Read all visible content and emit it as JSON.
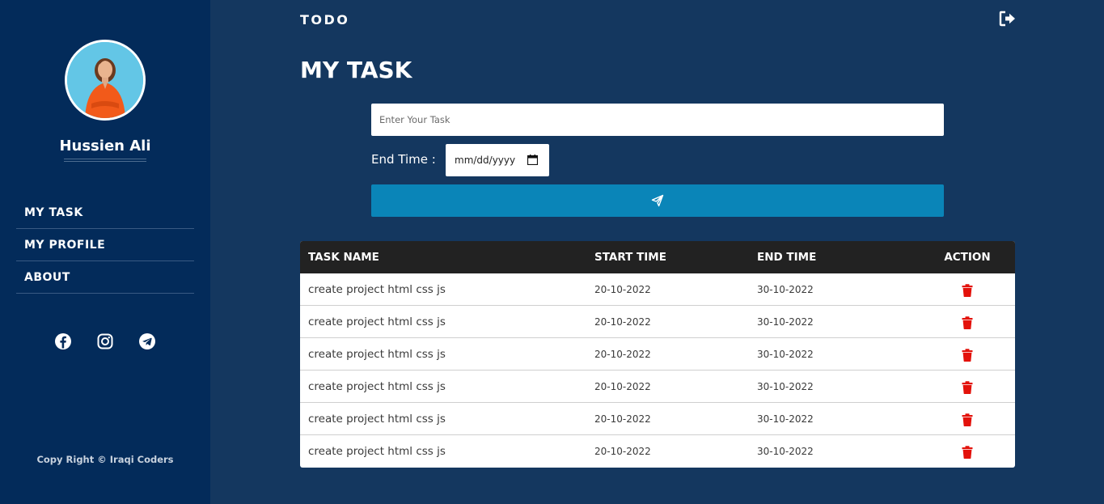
{
  "sidebar": {
    "user_name": "Hussien Ali",
    "nav": [
      {
        "label": "MY TASK"
      },
      {
        "label": "MY PROFILE"
      },
      {
        "label": "ABOUT"
      }
    ],
    "socials": [
      "facebook-icon",
      "instagram-icon",
      "telegram-icon"
    ],
    "copyright": "Copy Right © Iraqi Coders"
  },
  "header": {
    "brand": "TODO",
    "logout_icon": "sign-out-icon"
  },
  "main": {
    "title": "MY TASK",
    "task_placeholder": "Enter Your Task",
    "end_time_label": "End Time :",
    "date_placeholder": "mm/dd/yyyy",
    "submit_icon": "paper-plane-icon"
  },
  "table": {
    "headers": [
      "TASK NAME",
      "START TIME",
      "END TIME",
      "ACTION"
    ],
    "rows": [
      {
        "task": "create project html css js",
        "start": "20-10-2022",
        "end": "30-10-2022"
      },
      {
        "task": "create project html css js",
        "start": "20-10-2022",
        "end": "30-10-2022"
      },
      {
        "task": "create project html css js",
        "start": "20-10-2022",
        "end": "30-10-2022"
      },
      {
        "task": "create project html css js",
        "start": "20-10-2022",
        "end": "30-10-2022"
      },
      {
        "task": "create project html css js",
        "start": "20-10-2022",
        "end": "30-10-2022"
      },
      {
        "task": "create project html css js",
        "start": "20-10-2022",
        "end": "30-10-2022"
      }
    ]
  },
  "colors": {
    "sidebar_bg": "#032b5a",
    "main_bg": "#14375f",
    "button_bg": "#0a85b8",
    "table_header_bg": "#222222",
    "delete_icon": "#e3120b"
  }
}
